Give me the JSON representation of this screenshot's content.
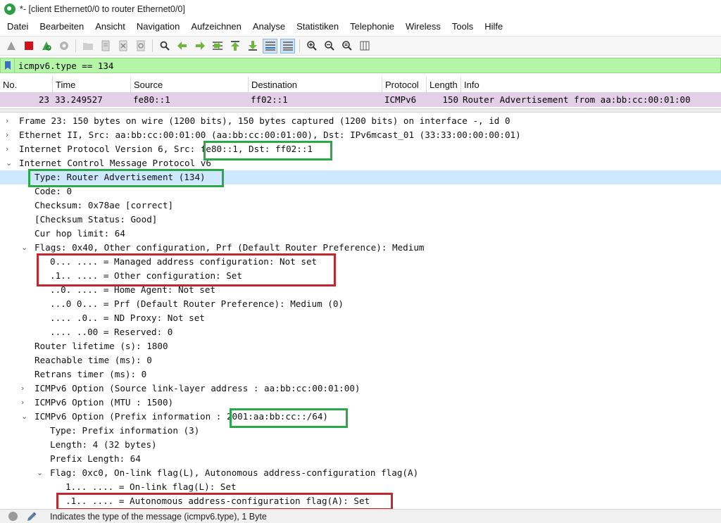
{
  "window": {
    "title": "*- [client Ethernet0/0 to router Ethernet0/0]",
    "accent_color": "#2e9e44"
  },
  "menu": [
    "Datei",
    "Bearbeiten",
    "Ansicht",
    "Navigation",
    "Aufzeichnen",
    "Analyse",
    "Statistiken",
    "Telephonie",
    "Wireless",
    "Tools",
    "Hilfe"
  ],
  "toolbar": {
    "icons": [
      "start-capture-icon",
      "stop-capture-icon",
      "restart-capture-icon",
      "capture-options-icon",
      "open-file-icon",
      "save-file-icon",
      "close-file-icon",
      "reload-file-icon",
      "find-packet-icon",
      "go-back-icon",
      "go-forward-icon",
      "go-to-packet-icon",
      "first-packet-icon",
      "last-packet-icon",
      "autoscroll-icon",
      "colorize-icon",
      "zoom-in-icon",
      "zoom-out-icon",
      "zoom-reset-icon",
      "resize-columns-icon"
    ]
  },
  "filter": {
    "value": "icmpv6.type == 134",
    "background_color": "#b4f5a8"
  },
  "packet_list": {
    "columns": [
      "No.",
      "Time",
      "Source",
      "Destination",
      "Protocol",
      "Length",
      "Info"
    ],
    "rows": [
      {
        "no": "23",
        "time": "33.249527",
        "source": "fe80::1",
        "destination": "ff02::1",
        "protocol": "ICMPv6",
        "length": "150",
        "info": "Router Advertisement from aa:bb:cc:00:01:00",
        "row_color": "#e3d0e8"
      }
    ]
  },
  "details": [
    {
      "arrow": "›",
      "text": "Frame 23: 150 bytes on wire (1200 bits), 150 bytes captured (1200 bits) on interface -, id 0"
    },
    {
      "arrow": "›",
      "text": "Ethernet II, Src: aa:bb:cc:00:01:00 (aa:bb:cc:00:01:00), Dst: IPv6mcast_01 (33:33:00:00:00:01)"
    },
    {
      "arrow": "›",
      "text": "Internet Protocol Version 6, Src: fe80::1, Dst: ff02::1"
    },
    {
      "arrow": "⌄",
      "text": "Internet Control Message Protocol v6"
    },
    {
      "arrow": "",
      "text": "Type: Router Advertisement (134)"
    },
    {
      "arrow": "",
      "text": "Code: 0"
    },
    {
      "arrow": "",
      "text": "Checksum: 0x78ae [correct]"
    },
    {
      "arrow": "",
      "text": "[Checksum Status: Good]"
    },
    {
      "arrow": "",
      "text": "Cur hop limit: 64"
    },
    {
      "arrow": "⌄",
      "text": "Flags: 0x40, Other configuration, Prf (Default Router Preference): Medium"
    },
    {
      "arrow": "",
      "text": "0... .... = Managed address configuration: Not set"
    },
    {
      "arrow": "",
      "text": ".1.. .... = Other configuration: Set"
    },
    {
      "arrow": "",
      "text": "..0. .... = Home Agent: Not set"
    },
    {
      "arrow": "",
      "text": "...0 0... = Prf (Default Router Preference): Medium (0)"
    },
    {
      "arrow": "",
      "text": ".... .0.. = ND Proxy: Not set"
    },
    {
      "arrow": "",
      "text": ".... ..00 = Reserved: 0"
    },
    {
      "arrow": "",
      "text": "Router lifetime (s): 1800"
    },
    {
      "arrow": "",
      "text": "Reachable time (ms): 0"
    },
    {
      "arrow": "",
      "text": "Retrans timer (ms): 0"
    },
    {
      "arrow": "›",
      "text": "ICMPv6 Option (Source link-layer address : aa:bb:cc:00:01:00)"
    },
    {
      "arrow": "›",
      "text": "ICMPv6 Option (MTU : 1500)"
    },
    {
      "arrow": "⌄",
      "text": "ICMPv6 Option (Prefix information : 2001:aa:bb:cc::/64)"
    },
    {
      "arrow": "",
      "text": "Type: Prefix information (3)"
    },
    {
      "arrow": "",
      "text": "Length: 4 (32 bytes)"
    },
    {
      "arrow": "",
      "text": "Prefix Length: 64"
    },
    {
      "arrow": "⌄",
      "text": "Flag: 0xc0, On-link flag(L), Autonomous address-configuration flag(A)"
    },
    {
      "arrow": "",
      "text": "1... .... = On-link flag(L): Set"
    },
    {
      "arrow": "",
      "text": ".1.. .... = Autonomous address-configuration flag(A): Set"
    }
  ],
  "highlights": {
    "green_color": "#2aa84a",
    "red_color": "#c0282f"
  },
  "status": {
    "text": "Indicates the type of the message (icmpv6.type), 1 Byte"
  }
}
